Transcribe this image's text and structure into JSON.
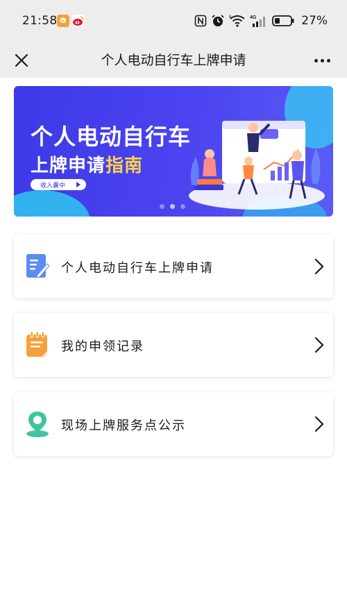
{
  "status_bar": {
    "time": "21:58",
    "battery_percent": "27%",
    "icons": [
      "shield-notification-icon",
      "weibo-icon",
      "nfc-icon",
      "alarm-icon",
      "wifi-icon",
      "4g-signal-icon",
      "battery-icon"
    ]
  },
  "nav": {
    "title": "个人电动自行车上牌申请",
    "close_icon": "close-icon",
    "more_icon": "more-icon"
  },
  "banner": {
    "line1": "个人电动自行车",
    "line2_prefix": "上牌申请",
    "line2_highlight": "指南",
    "pill_label": "收入囊中",
    "dot_count": 3,
    "active_dot_index": 1,
    "colors": {
      "bg": "#4a45ec",
      "highlight": "#ffd34a",
      "accent": "#2fc7f0"
    }
  },
  "menu": {
    "items": [
      {
        "label": "个人电动自行车上牌申请",
        "icon": "edit-document-icon",
        "icon_color": "#5b8def"
      },
      {
        "label": "我的申领记录",
        "icon": "notepad-icon",
        "icon_color": "#f5a13a"
      },
      {
        "label": "现场上牌服务点公示",
        "icon": "location-pin-icon",
        "icon_color": "#3fc4a0"
      }
    ]
  }
}
